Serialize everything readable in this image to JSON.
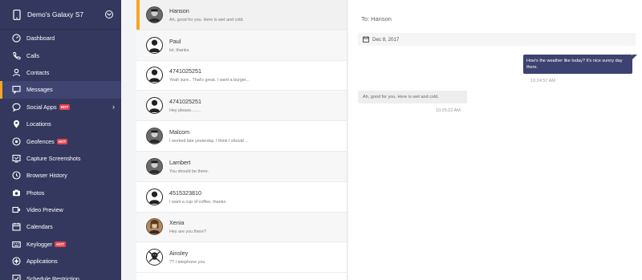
{
  "sidebar": {
    "device_name": "Demo's Galaxy S7",
    "items": [
      {
        "label": "Dashboard",
        "icon": "dashboard-icon"
      },
      {
        "label": "Calls",
        "icon": "phone-icon"
      },
      {
        "label": "Contacts",
        "icon": "contacts-icon"
      },
      {
        "label": "Messages",
        "icon": "message-icon",
        "active": true
      },
      {
        "label": "Social Apps",
        "icon": "chat-bubble-icon",
        "badge": "HOT",
        "arrow": true
      },
      {
        "label": "Locations",
        "icon": "map-pin-icon"
      },
      {
        "label": "Geofences",
        "icon": "geofence-icon",
        "badge": "HOT"
      },
      {
        "label": "Capture Screenshots",
        "icon": "screenshot-icon"
      },
      {
        "label": "Browser History",
        "icon": "history-icon"
      },
      {
        "label": "Photos",
        "icon": "camera-icon"
      },
      {
        "label": "Video Preview",
        "icon": "video-icon"
      },
      {
        "label": "Calendars",
        "icon": "calendar-icon"
      },
      {
        "label": "Keylogger",
        "icon": "keyboard-icon",
        "badge": "HOT"
      },
      {
        "label": "Applications",
        "icon": "apps-icon"
      },
      {
        "label": "Schedule Restriction",
        "icon": "schedule-icon"
      }
    ]
  },
  "conversations": [
    {
      "name": "Hanson",
      "preview": "Ah, good for you. Here is wet and cold."
    },
    {
      "name": "Paul",
      "preview": "lol, thanks."
    },
    {
      "name": "4741025251",
      "preview": "Yeah sure.. That's great. I want a burger..."
    },
    {
      "name": "4741025251",
      "preview": "Hey please........"
    },
    {
      "name": "Malcom",
      "preview": "I worked late yesterday. I think I should ..."
    },
    {
      "name": "Lambert",
      "preview": "You should be there."
    },
    {
      "name": "4515323810",
      "preview": "I want a cup of coffee, thanks."
    },
    {
      "name": "Xenia",
      "preview": "Hey are you there?"
    },
    {
      "name": "Ainsley",
      "preview": "?? I telephone you."
    }
  ],
  "chat": {
    "to_label": "To: Hanson",
    "date": "Dec 8, 2017",
    "outgoing": {
      "text": "How's the weather like today? It's nice sunny day there.",
      "time": "10:24:57 AM"
    },
    "incoming": {
      "text": "Ah, good for you. Here is wet and cold.",
      "time": "10:25:22 AM"
    }
  },
  "colors": {
    "sidebar_bg": "#34385e",
    "accent": "#f5a623",
    "hot_badge": "#e8434e",
    "outgoing_bubble": "#3d4270"
  }
}
